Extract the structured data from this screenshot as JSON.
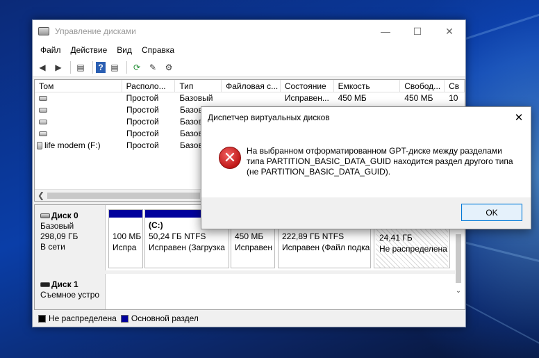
{
  "window": {
    "title": "Управление дисками",
    "controls": {
      "minimize": "—",
      "maximize": "☐",
      "close": "✕"
    }
  },
  "menu": [
    "Файл",
    "Действие",
    "Вид",
    "Справка"
  ],
  "toolbar_icons": [
    "back-icon",
    "forward-icon",
    "show-hide-icon",
    "help-icon",
    "properties-icon",
    "refresh-icon",
    "rescan-icon",
    "settings-icon"
  ],
  "volumes": {
    "columns": [
      "Том",
      "Располо...",
      "Тип",
      "Файловая с...",
      "Состояние",
      "Емкость",
      "Свобод...",
      "Св"
    ],
    "rows": [
      [
        "",
        "Простой",
        "Базовый",
        "",
        "Исправен...",
        "450 МБ",
        "450 МБ",
        "10"
      ],
      [
        "",
        "Простой",
        "Базовый",
        "",
        "",
        "",
        "",
        ""
      ],
      [
        "",
        "Простой",
        "Базовый",
        "",
        "",
        "",
        "",
        ""
      ],
      [
        "",
        "Простой",
        "Базов",
        "",
        "",
        "",
        "",
        ""
      ],
      [
        "life modem (F:)",
        "Простой",
        "Базов",
        "",
        "",
        "",
        "",
        ""
      ]
    ]
  },
  "disks": [
    {
      "name": "Диск 0",
      "lines": [
        "Базовый",
        "298,09 ГБ",
        "В сети"
      ],
      "partitions": [
        {
          "line1": "100 МБ",
          "line2": "Испра",
          "line0": ""
        },
        {
          "line0": "(C:)",
          "line1": "50,24 ГБ NTFS",
          "line2": "Исправен (Загрузка"
        },
        {
          "line0": "",
          "line1": "450 МБ",
          "line2": "Исправен"
        },
        {
          "line0": "",
          "line1": "222,89 ГБ NTFS",
          "line2": "Исправен (Файл подка"
        },
        {
          "line0": "",
          "line1": "24,41 ГБ",
          "line2": "Не распределена"
        }
      ]
    },
    {
      "name": "Диск 1",
      "lines": [
        "Съемное устро"
      ]
    }
  ],
  "legend": [
    {
      "label": "Не распределена",
      "color": "#000000"
    },
    {
      "label": "Основной раздел",
      "color": "#00009c"
    }
  ],
  "dialog": {
    "title": "Диспетчер виртуальных дисков",
    "close": "✕",
    "icon": "error-icon",
    "message_lines": [
      "На выбранном отформатированном GPT-диске между разделами",
      "типа PARTITION_BASIC_DATA_GUID находится раздел другого типа",
      "(не PARTITION_BASIC_DATA_GUID)."
    ],
    "ok_label": "OK"
  }
}
